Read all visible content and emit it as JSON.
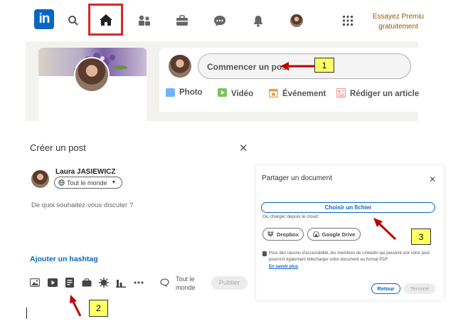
{
  "nav": {
    "logo_text": "in",
    "premium_line1": "Essayez Premiu",
    "premium_line2": "gratuitement",
    "icons": [
      "search-icon",
      "home-icon",
      "network-icon",
      "jobs-icon",
      "messaging-icon",
      "notifications-icon",
      "profile-avatar",
      "grid-icon"
    ]
  },
  "share": {
    "start_post": "Commencer un post",
    "actions": {
      "photo": "Photo",
      "video": "Vidéo",
      "event": "Événement",
      "article": "Rédiger un article"
    }
  },
  "callouts": {
    "one": "1",
    "two": "2",
    "three": "3"
  },
  "create_post": {
    "title": "Créer un post",
    "close": "✕",
    "author": "Laura JASIEWICZ",
    "visibility": "Tout le monde",
    "prompt": "De quoi souhaitez-vous discuter ?",
    "hashtag": "Ajouter un hashtag",
    "audience_line1": "Tout le",
    "audience_line2": "monde",
    "publish": "Publier"
  },
  "share_document": {
    "title": "Partager un document",
    "close": "✕",
    "choose_file": "Choisir un fichier",
    "cloud_label": "Ou charger depuis le cloud :",
    "dropbox": "Dropbox",
    "google_drive": "Google Drive",
    "accessibility_note": "Pour des raisons d'accessibilité, les membres de LinkedIn qui peuvent voir votre post pourront également télécharger votre document au format PDF.",
    "learn_more": "En savoir plus",
    "back": "Retour",
    "done": "Terminé"
  },
  "colors": {
    "brand": "#0a66c2",
    "highlight_red": "#d92828",
    "callout_yellow": "#ffff66"
  }
}
